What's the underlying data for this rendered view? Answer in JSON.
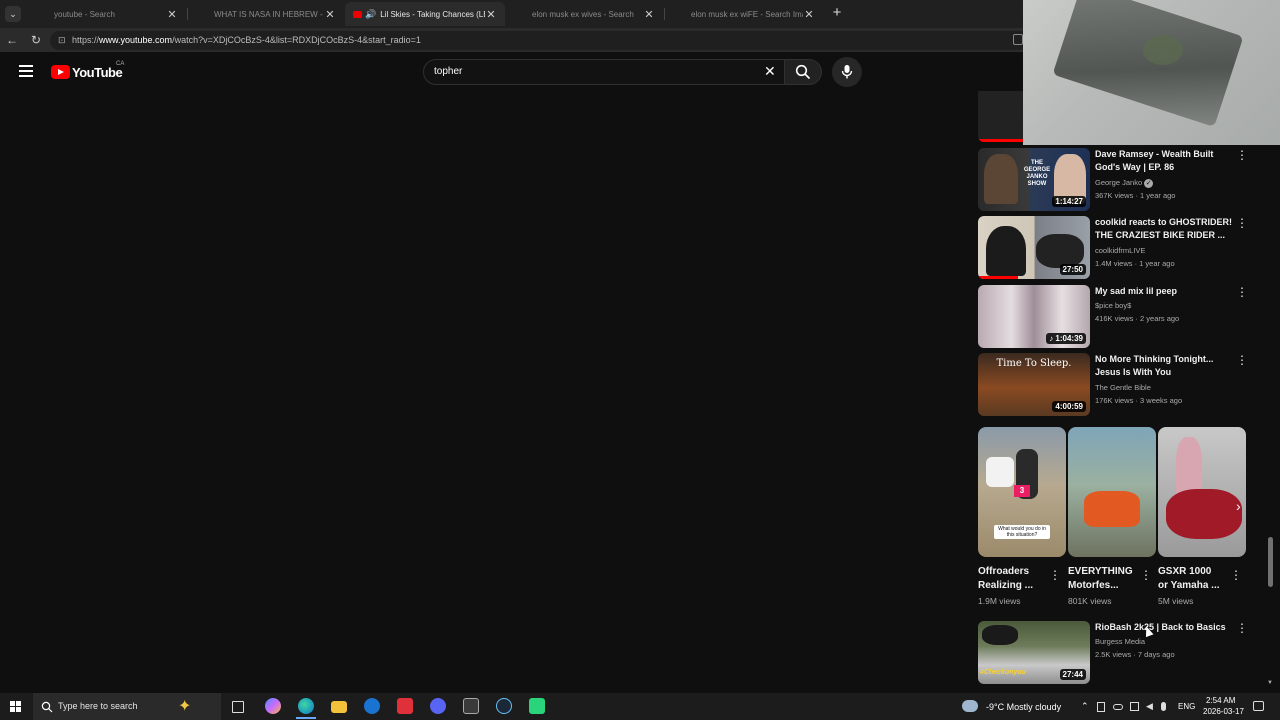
{
  "browser": {
    "tabs": [
      {
        "title": "youtube - Search",
        "active": false
      },
      {
        "title": "WHAT IS NASA IN HEBREW - Sea",
        "active": false
      },
      {
        "title": "Lil Skies - Taking Chances (LEA",
        "active": true
      },
      {
        "title": "elon musk ex wives - Search",
        "active": false
      },
      {
        "title": "elon musk ex wiFE - Search Image",
        "active": false
      }
    ],
    "url_prefix": "https://",
    "url_domain": "www.youtube.com",
    "url_path": "/watch?v=XDjCOcBzS-4&list=RDXDjCOcBzS-4&start_radio=1"
  },
  "youtube": {
    "logo_text": "YouTube",
    "country": "CA",
    "search_value": "topher"
  },
  "videos": [
    {
      "title": "Dave Ramsey - Wealth Built God's Way | EP. 86",
      "channel": "George Janko",
      "verified": true,
      "meta": "367K views · 1 year ago",
      "duration": "1:14:27",
      "thumb_text": "THE GEORGE JANKO SHOW"
    },
    {
      "title": "coolkid reacts to GHOSTRIDER! THE CRAZIEST BIKE RIDER ...",
      "channel": "coolkidfrmLIVE",
      "verified": false,
      "meta": "1.4M views · 1 year ago",
      "duration": "27:50"
    },
    {
      "title": "My sad mix lil peep",
      "channel": "$pice boy$",
      "verified": false,
      "meta": "416K views · 2 years ago",
      "duration": "1:04:39"
    },
    {
      "title": "No More Thinking Tonight... Jesus Is With You",
      "channel": "The Gentle Bible",
      "verified": false,
      "meta": "176K views · 3 weeks ago",
      "duration": "4:00:59",
      "thumb_text": "Time To Sleep."
    },
    {
      "title": "RioBash 2k25 | Back to Basics",
      "channel": "Burgess Media",
      "verified": false,
      "meta": "2.5K views · 7 days ago",
      "duration": "27:44",
      "thumb_text": "#Checkonyou"
    }
  ],
  "shorts": [
    {
      "title": "Offroaders Realizing ...",
      "views": "1.9M views",
      "overlay": "What would you do in this situation?",
      "badge": "3"
    },
    {
      "title": "EVERYTHING Motorfes...",
      "views": "801K views"
    },
    {
      "title": "GSXR 1000 or Yamaha ...",
      "views": "5M views"
    }
  ],
  "taskbar": {
    "search_placeholder": "Type here to search",
    "weather": "-9°C  Mostly cloudy",
    "lang": "ENG",
    "time": "2:54 AM",
    "date": "2026-03-17"
  }
}
